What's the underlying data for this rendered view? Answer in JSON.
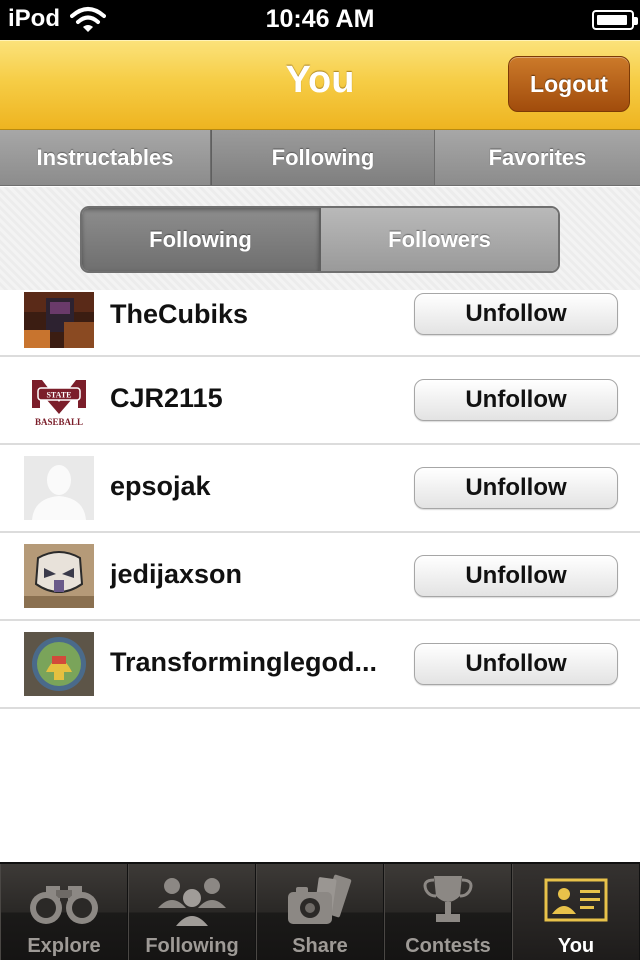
{
  "status_bar": {
    "carrier": "iPod",
    "time": "10:46 AM"
  },
  "nav": {
    "title": "You",
    "logout_label": "Logout"
  },
  "top_tabs": [
    {
      "label": "Instructables",
      "active": false
    },
    {
      "label": "Following",
      "active": true
    },
    {
      "label": "Favorites",
      "active": false
    }
  ],
  "segments": [
    {
      "label": "Following",
      "active": true
    },
    {
      "label": "Followers",
      "active": false
    }
  ],
  "users": [
    {
      "name": "TheCubiks",
      "button": "Unfollow"
    },
    {
      "name": "CJR2115",
      "button": "Unfollow"
    },
    {
      "name": "epsojak",
      "button": "Unfollow"
    },
    {
      "name": "jedijaxson",
      "button": "Unfollow"
    },
    {
      "name": "Transforminglegod...",
      "button": "Unfollow"
    }
  ],
  "avatar_badge": {
    "line1": "STATE",
    "line2": "BASEBALL"
  },
  "tab_bar": [
    {
      "label": "Explore",
      "icon": "binoculars-icon",
      "active": false
    },
    {
      "label": "Following",
      "icon": "people-icon",
      "active": false
    },
    {
      "label": "Share",
      "icon": "camera-icon",
      "active": false
    },
    {
      "label": "Contests",
      "icon": "trophy-icon",
      "active": false
    },
    {
      "label": "You",
      "icon": "profile-card-icon",
      "active": true
    }
  ],
  "colors": {
    "nav_yellow": "#f6cd46",
    "logout_brown": "#a14c0c",
    "tab_bar_dark": "#2a2826",
    "active_tab_gold": "#e8c24a"
  }
}
